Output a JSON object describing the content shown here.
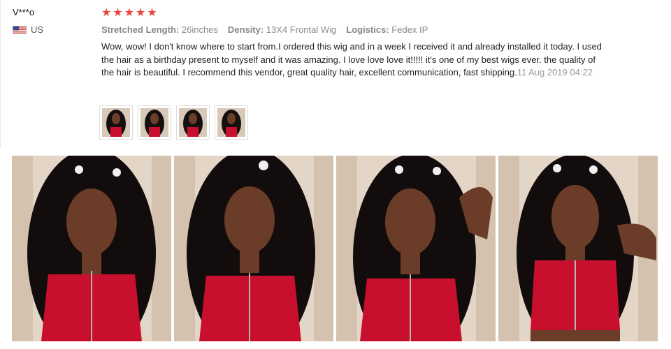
{
  "user": {
    "name": "V***o",
    "country": "US",
    "flag_icon": "us-flag-icon"
  },
  "rating": {
    "stars": 5,
    "max": 5,
    "star_color": "#e9453e"
  },
  "attributes": [
    {
      "key": "Stretched Length:",
      "value": "26inches"
    },
    {
      "key": "Density:",
      "value": "13X4 Frontal Wig"
    },
    {
      "key": "Logistics:",
      "value": "Fedex IP"
    }
  ],
  "review": {
    "text": "Wow, wow! I don't know where to start from.I ordered this wig and in a week I received it and already installed it today. I used the hair as a birthday present to myself and it was amazing. I love love love it!!!!!  it's one of my best wigs ever. the quality of the hair is beautiful. I recommend this vendor, great quality hair, excellent communication, fast shipping.",
    "date": "11 Aug 2019 04:22"
  },
  "thumbnails_count": 4,
  "photos_count": 4
}
